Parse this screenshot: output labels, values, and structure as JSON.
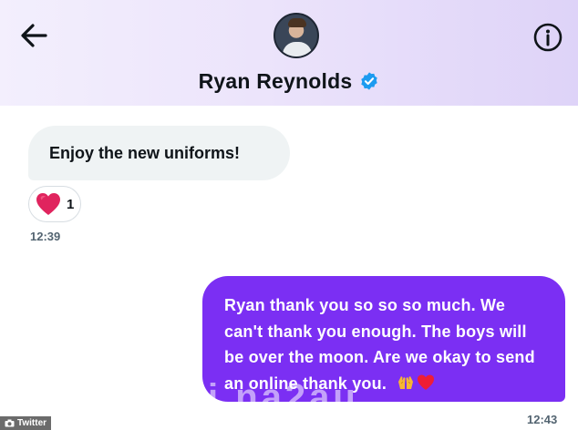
{
  "header": {
    "contact_name": "Ryan Reynolds",
    "avatar_icon": "avatar-photo",
    "verified_icon": "verified-badge-icon",
    "back_icon": "arrow-left-icon",
    "info_icon": "info-icon",
    "verified_color": "#1d9bf0",
    "background_color": "#ece4fb"
  },
  "messages": [
    {
      "direction": "incoming",
      "text": "Enjoy the new uniforms!",
      "reaction": {
        "icon": "heart-icon",
        "count": "1"
      },
      "time": "12:39"
    },
    {
      "direction": "outgoing",
      "text": "Ryan thank you so so so much. We can't thank you enough. The boys will be over the moon. Are we okay to send an online thank you.",
      "emoji_icons": [
        "raising-hands-icon",
        "heart-icon"
      ],
      "time": "12:43"
    }
  ],
  "colors": {
    "outgoing_bubble": "#7b2ff3",
    "incoming_bubble": "#eff3f4",
    "heart": "#e0245e"
  },
  "watermark": {
    "source_label": "Twitter",
    "overlay_text": "i na2au"
  }
}
